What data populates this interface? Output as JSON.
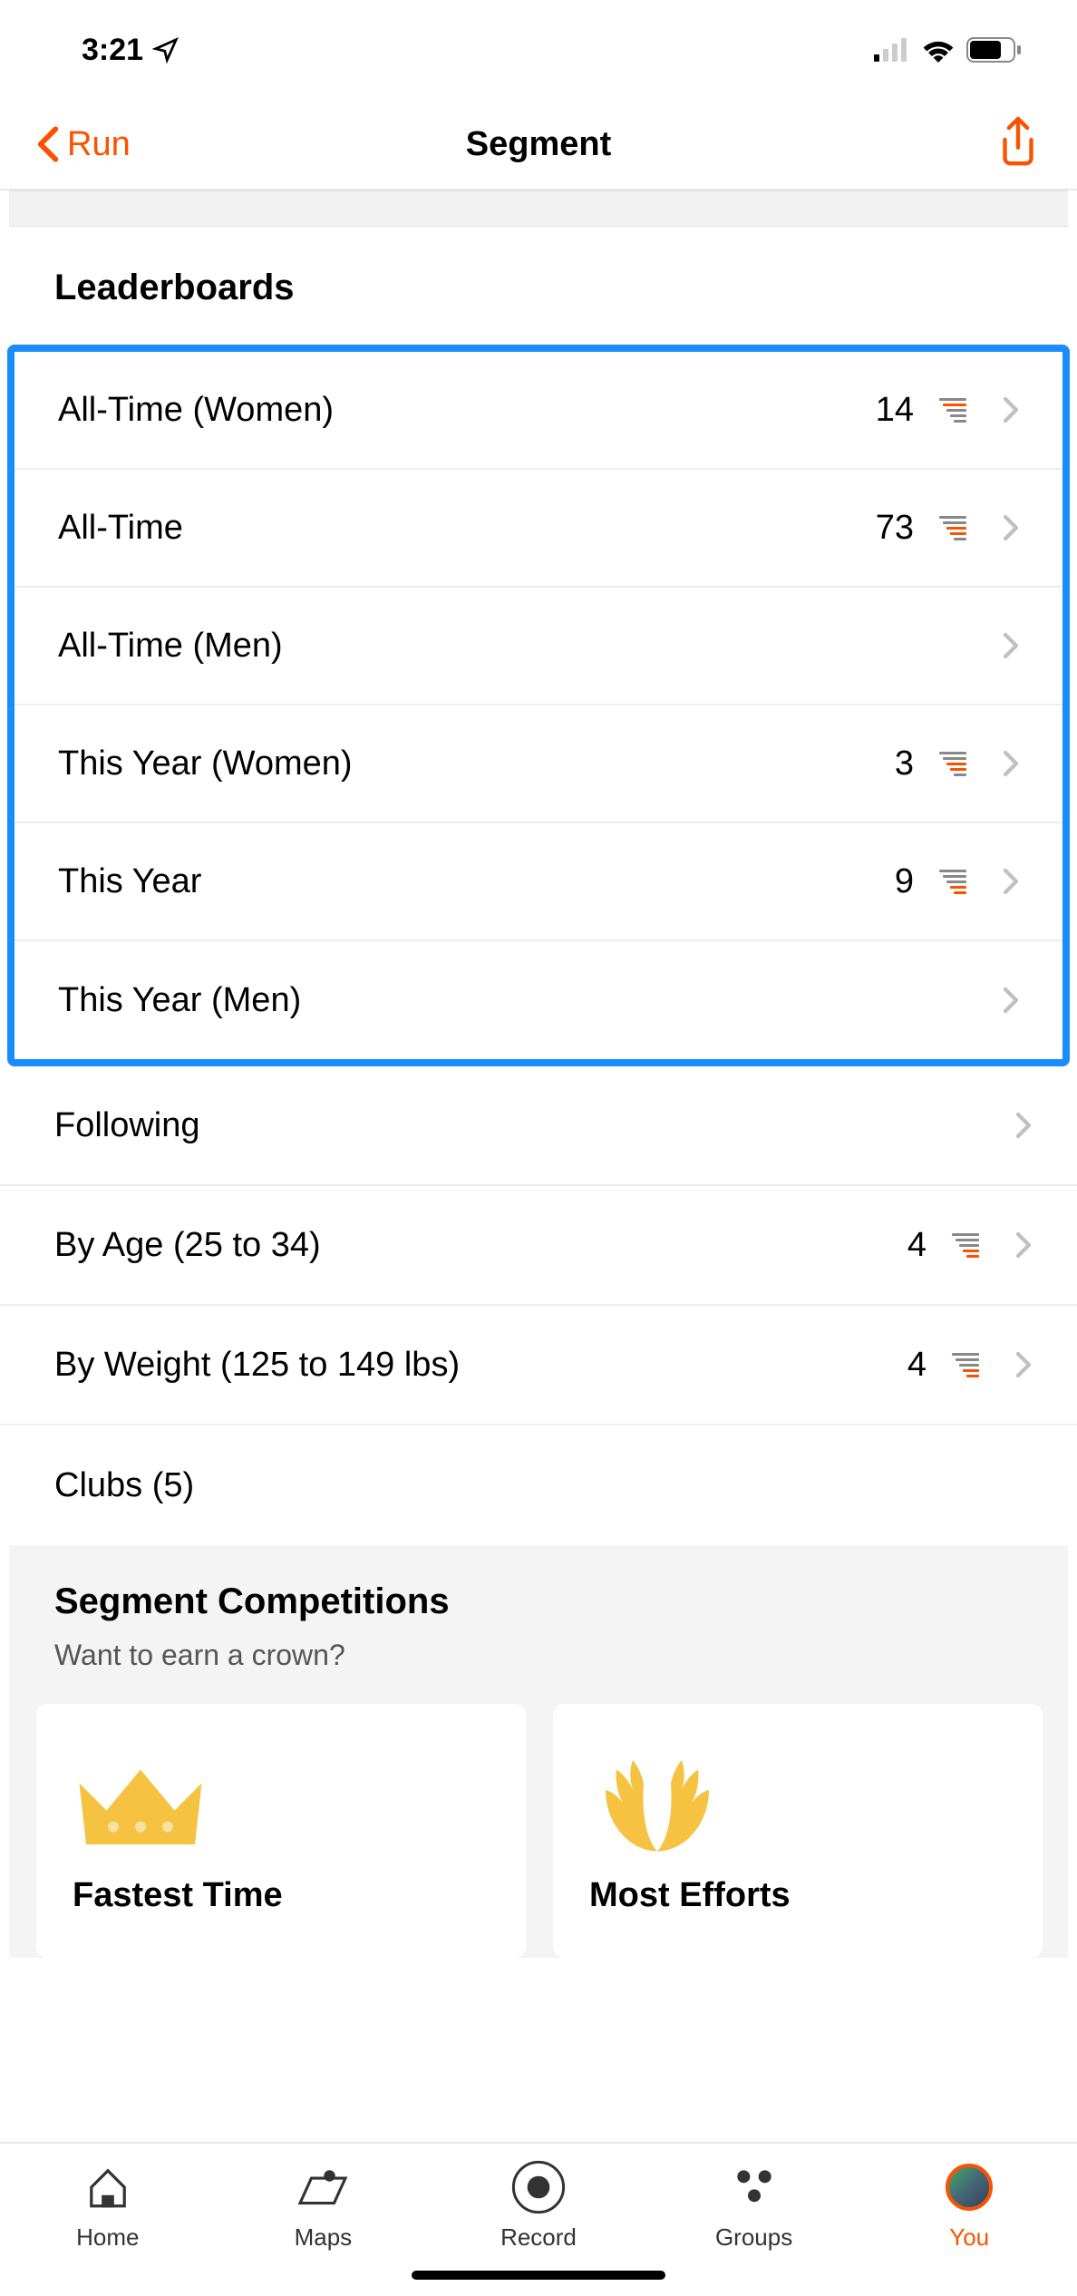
{
  "status": {
    "time": "3:21"
  },
  "header": {
    "back_label": "Run",
    "title": "Segment"
  },
  "section_title": "Leaderboards",
  "highlighted_rows": [
    {
      "label": "All-Time (Women)",
      "value": "14",
      "has_rank": true,
      "rank_pos": "top"
    },
    {
      "label": "All-Time",
      "value": "73",
      "has_rank": true,
      "rank_pos": "mid"
    },
    {
      "label": "All-Time (Men)",
      "value": "",
      "has_rank": false
    },
    {
      "label": "This Year (Women)",
      "value": "3",
      "has_rank": true,
      "rank_pos": "mid"
    },
    {
      "label": "This Year",
      "value": "9",
      "has_rank": true,
      "rank_pos": "bot"
    },
    {
      "label": "This Year (Men)",
      "value": "",
      "has_rank": false
    }
  ],
  "other_rows": [
    {
      "label": "Following",
      "value": "",
      "has_rank": false
    },
    {
      "label": "By Age (25 to 34)",
      "value": "4",
      "has_rank": true,
      "rank_pos": "bot"
    },
    {
      "label": "By Weight (125 to 149 lbs)",
      "value": "4",
      "has_rank": true,
      "rank_pos": "bot"
    },
    {
      "label": "Clubs (5)",
      "value": "",
      "has_rank": false,
      "no_chevron": true
    }
  ],
  "competitions": {
    "title": "Segment Competitions",
    "subtitle": "Want to earn a crown?",
    "cards": [
      {
        "title": "Fastest Time",
        "icon": "crown"
      },
      {
        "title": "Most Efforts",
        "icon": "laurel"
      }
    ]
  },
  "tabs": [
    {
      "label": "Home",
      "icon": "home"
    },
    {
      "label": "Maps",
      "icon": "maps"
    },
    {
      "label": "Record",
      "icon": "record"
    },
    {
      "label": "Groups",
      "icon": "groups"
    },
    {
      "label": "You",
      "icon": "you",
      "active": true
    }
  ]
}
